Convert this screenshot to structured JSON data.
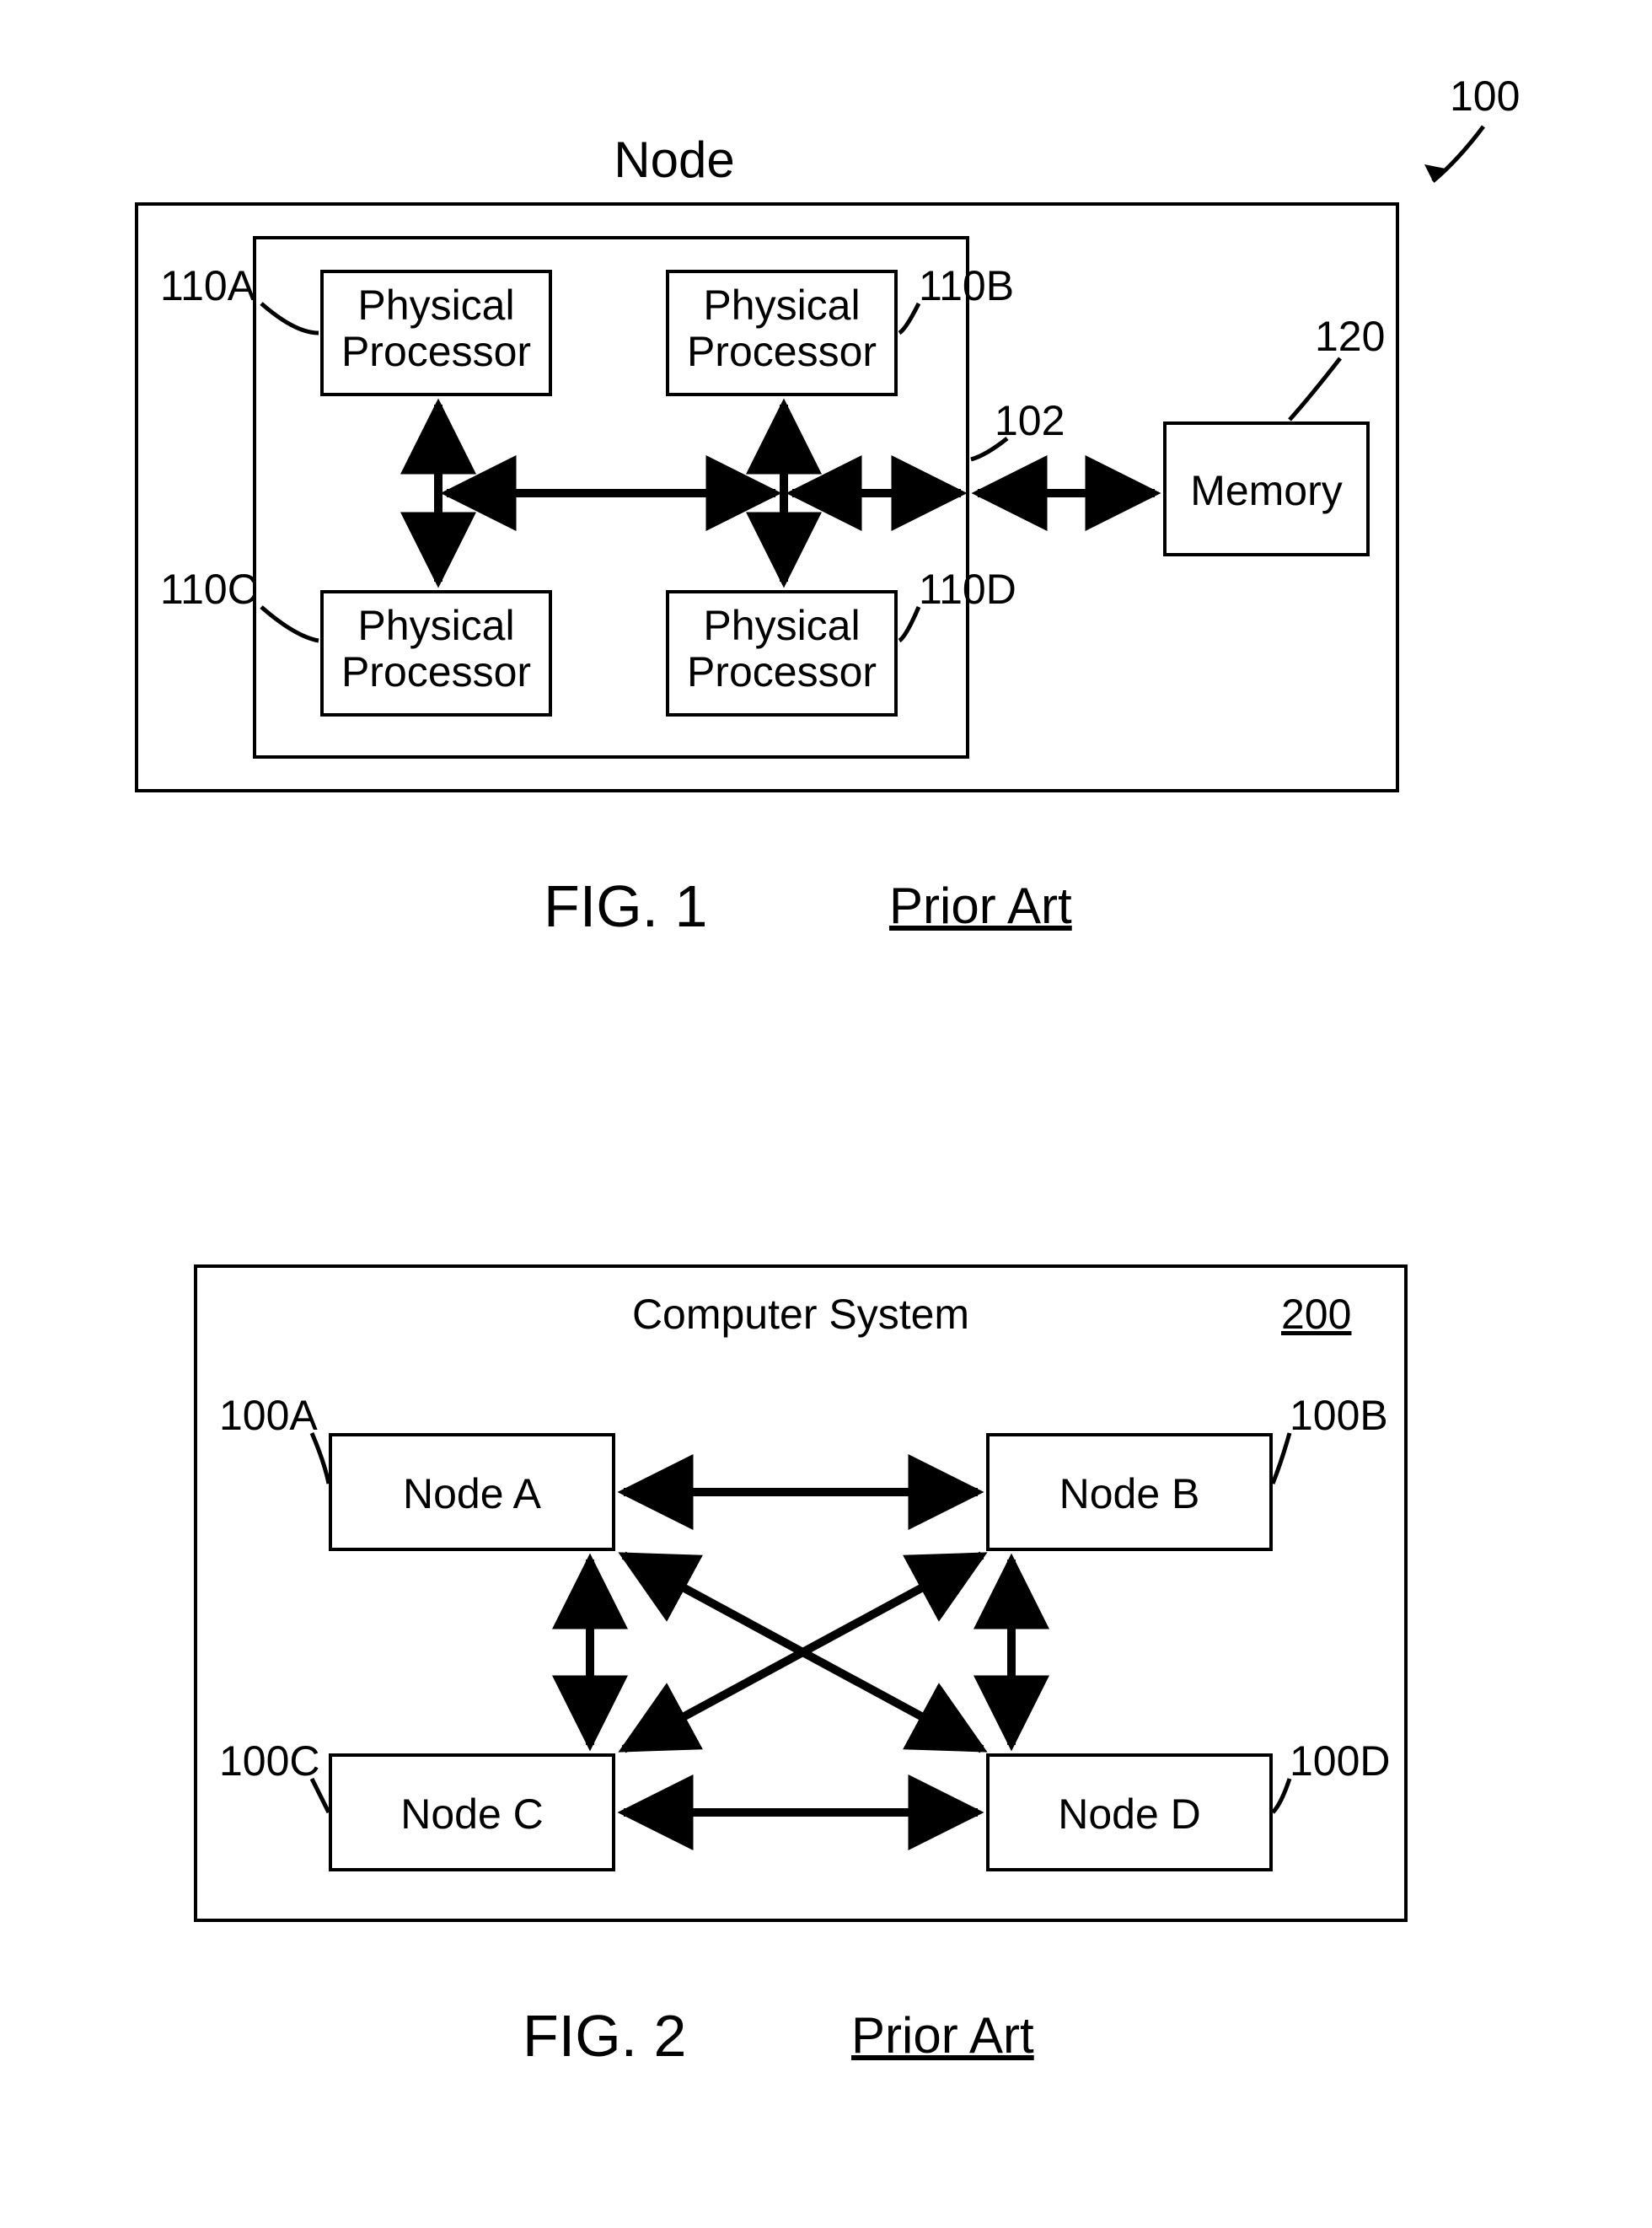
{
  "fig1": {
    "title": "Node",
    "ref_main": "100",
    "ref_inner": "102",
    "ref_memory": "120",
    "proc_text": "Physical\nProcessor",
    "memory_text": "Memory",
    "refs": {
      "a": "110A",
      "b": "110B",
      "c": "110C",
      "d": "110D"
    },
    "caption_fig": "FIG. 1",
    "caption_prior": "Prior Art"
  },
  "fig2": {
    "title": "Computer System",
    "ref_sys": "200",
    "nodes": {
      "a": "Node A",
      "b": "Node B",
      "c": "Node C",
      "d": "Node D"
    },
    "refs": {
      "a": "100A",
      "b": "100B",
      "c": "100C",
      "d": "100D"
    },
    "caption_fig": "FIG. 2",
    "caption_prior": "Prior Art"
  }
}
